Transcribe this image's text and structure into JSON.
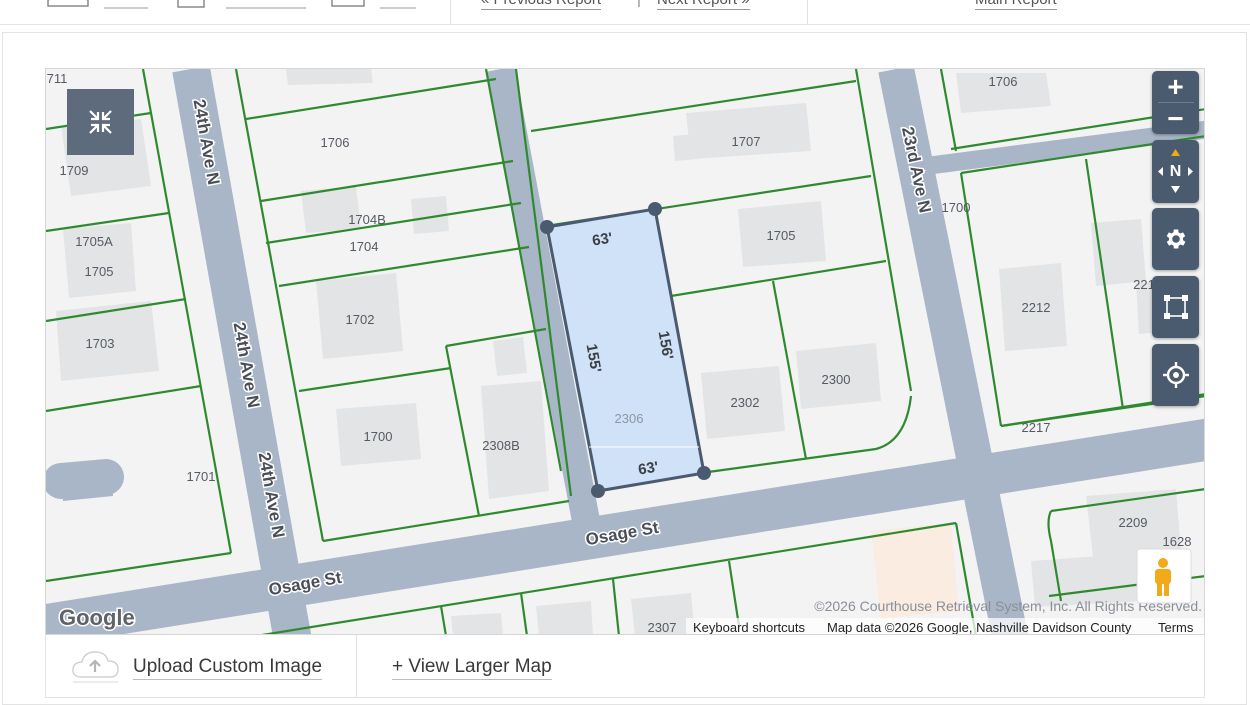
{
  "toolbar": {
    "previous_report": "« Previous Report",
    "next_report": "Next Report »",
    "separator": "|",
    "right_link": "Main Report"
  },
  "map": {
    "streets": {
      "s24_a": "24th Ave N",
      "s24_b": "24th Ave N",
      "s24_c": "24th Ave N",
      "s23": "23rd Ave N",
      "osage_a": "Osage St",
      "osage_b": "Osage St"
    },
    "parcels": [
      "711",
      "1706",
      "1709",
      "1705A",
      "1705",
      "1703",
      "1704B",
      "1704",
      "1702",
      "1700",
      "2308B",
      "1701",
      "1707",
      "1705",
      "2302",
      "2300",
      "1706",
      "1700",
      "2212",
      "221",
      "2217",
      "2209",
      "1628",
      "2307"
    ],
    "selected_parcel": {
      "label": "2306",
      "dims": {
        "top": "63'",
        "left": "155'",
        "right": "156'",
        "bottom": "63'"
      },
      "color": "#cfe2f7"
    },
    "controls": {
      "zoom_in": "+",
      "zoom_out": "−",
      "compass": "N"
    },
    "copyright": "©2026 Courthouse Retrieval System, Inc. All Rights Reserved.",
    "attribution": {
      "shortcuts": "Keyboard shortcuts",
      "mapdata": "Map data ©2026 Google, Nashville Davidson County",
      "terms": "Terms"
    },
    "google_logo": "Google",
    "colors": {
      "parcel_line": "#2f8a2f",
      "road": "#a9b6c7",
      "background": "#f3f3f4"
    }
  },
  "footer": {
    "upload_label": "Upload Custom Image",
    "view_larger": "+ View Larger Map"
  }
}
